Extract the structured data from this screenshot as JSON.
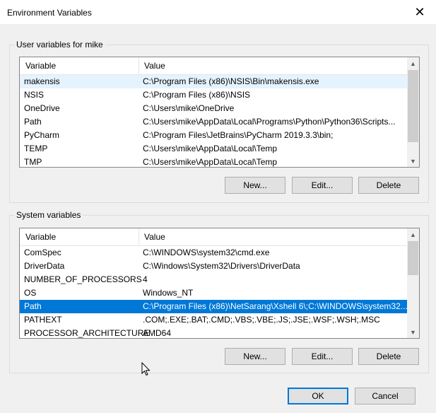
{
  "window": {
    "title": "Environment Variables"
  },
  "user_section": {
    "label": "User variables for mike",
    "columns": [
      "Variable",
      "Value"
    ],
    "rows": [
      {
        "variable": "makensis",
        "value": "C:\\Program Files (x86)\\NSIS\\Bin\\makensis.exe"
      },
      {
        "variable": "NSIS",
        "value": "C:\\Program Files (x86)\\NSIS"
      },
      {
        "variable": "OneDrive",
        "value": "C:\\Users\\mike\\OneDrive"
      },
      {
        "variable": "Path",
        "value": "C:\\Users\\mike\\AppData\\Local\\Programs\\Python\\Python36\\Scripts..."
      },
      {
        "variable": "PyCharm",
        "value": "C:\\Program Files\\JetBrains\\PyCharm 2019.3.3\\bin;"
      },
      {
        "variable": "TEMP",
        "value": "C:\\Users\\mike\\AppData\\Local\\Temp"
      },
      {
        "variable": "TMP",
        "value": "C:\\Users\\mike\\AppData\\Local\\Temp"
      }
    ],
    "buttons": {
      "new": "New...",
      "edit": "Edit...",
      "delete": "Delete"
    }
  },
  "system_section": {
    "label": "System variables",
    "columns": [
      "Variable",
      "Value"
    ],
    "rows": [
      {
        "variable": "ComSpec",
        "value": "C:\\WINDOWS\\system32\\cmd.exe"
      },
      {
        "variable": "DriverData",
        "value": "C:\\Windows\\System32\\Drivers\\DriverData"
      },
      {
        "variable": "NUMBER_OF_PROCESSORS",
        "value": "4"
      },
      {
        "variable": "OS",
        "value": "Windows_NT"
      },
      {
        "variable": "Path",
        "value": "C:\\Program Files (x86)\\NetSarang\\Xshell 6\\;C:\\WINDOWS\\system32..."
      },
      {
        "variable": "PATHEXT",
        "value": ".COM;.EXE;.BAT;.CMD;.VBS;.VBE;.JS;.JSE;.WSF;.WSH;.MSC"
      },
      {
        "variable": "PROCESSOR_ARCHITECTURE",
        "value": "AMD64"
      }
    ],
    "selected_row": "Path",
    "buttons": {
      "new": "New...",
      "edit": "Edit...",
      "delete": "Delete"
    }
  },
  "footer": {
    "ok": "OK",
    "cancel": "Cancel"
  },
  "icons": {
    "close": "close-icon",
    "scroll_up": "chevron-up-icon",
    "scroll_down": "chevron-down-icon",
    "cursor": "mouse-pointer-icon"
  },
  "colors": {
    "selection": "#0078d7",
    "hover": "#e5f3ff",
    "default_button_border": "#0078d7"
  }
}
